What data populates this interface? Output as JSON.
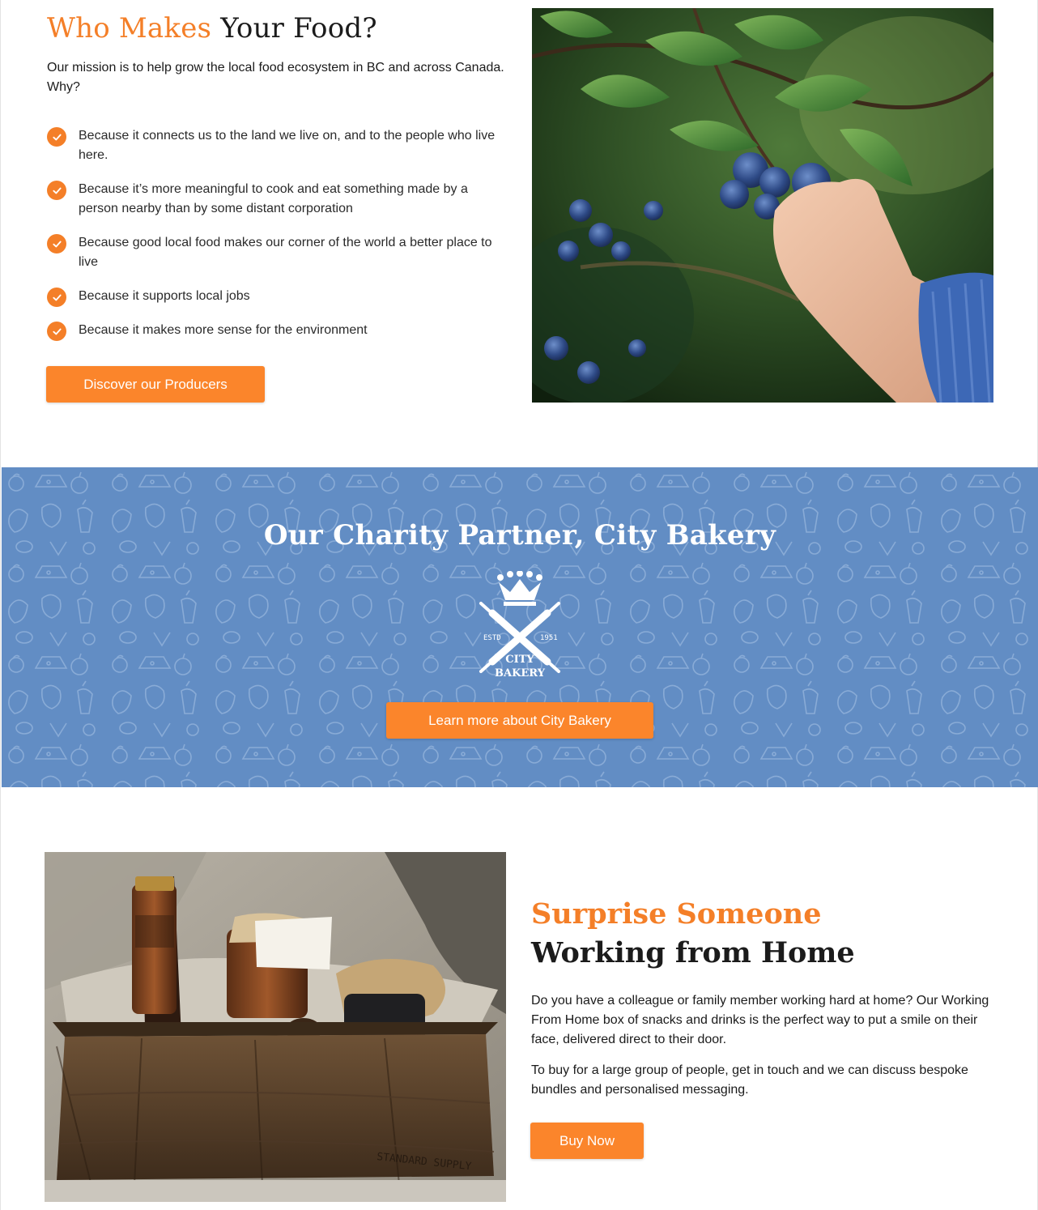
{
  "intro_section": {
    "title_accent": "Who Makes",
    "title_rest": "Your Food?",
    "mission": "Our mission is to help grow the local food ecosystem in BC and across Canada.  Why?",
    "reasons": [
      "Because it connects us to the land we live on, and to the people who live here.",
      "Because it’s more meaningful to cook and eat something made by a person nearby than by some distant corporation",
      "Because good local food makes our corner of the world a better place to live",
      "Because it supports local jobs",
      "Because it makes more sense for the environment"
    ],
    "button_label": "Discover our Producers",
    "image_icon": "blueberry-picking-photo"
  },
  "charity_section": {
    "title": "Our Charity Partner, City Bakery",
    "logo": {
      "line1": "CITY",
      "line2": "BAKERY",
      "estd": "ESTD",
      "year": "1951"
    },
    "button_label": "Learn more about City Bakery",
    "background_color": "#628dc4"
  },
  "gift_section": {
    "title_accent": "Surprise Someone",
    "title_rest": "Working from Home",
    "paragraph1": "Do you have a colleague or family member working hard at home? Our Working From Home box of snacks and drinks is the perfect way to put a smile on their face, delivered direct to their door.",
    "paragraph2": "To buy for a large group of people, get in touch and we can discuss bespoke bundles and personalised messaging.",
    "button_label": "Buy Now",
    "image_icon": "gift-box-photo",
    "crate_text": "STANDARD SUPPLY"
  },
  "colors": {
    "accent": "#f47f28",
    "button": "#fb852b",
    "charity_blue": "#628dc4"
  }
}
